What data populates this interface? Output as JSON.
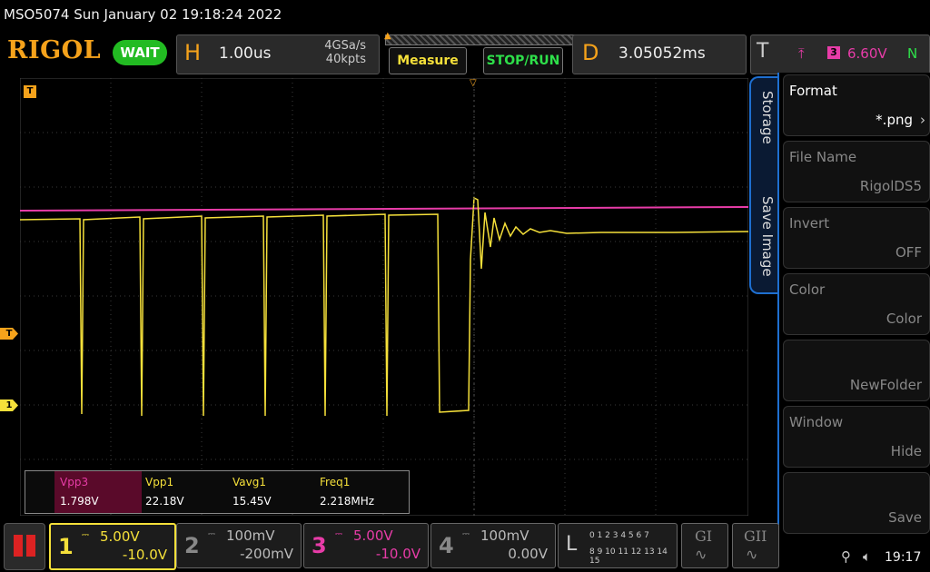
{
  "status": {
    "text": "MSO5074  Sun January 02 19:18:24 2022"
  },
  "header": {
    "logo": "RIGOL",
    "run_state": "WAIT",
    "horizontal": {
      "letter": "H",
      "timebase": "1.00us",
      "sample_rate": "4GSa/s",
      "memory": "40kpts"
    },
    "measure_label": "Measure",
    "stoprun_label": "STOP/RUN",
    "delay": {
      "letter": "D",
      "value": "3.05052ms"
    },
    "trigger": {
      "letter": "T",
      "source": "3",
      "level": "6.60V",
      "mode": "N"
    }
  },
  "side_tabs": {
    "storage": "Storage",
    "save_image": "Save Image"
  },
  "menu": [
    {
      "title": "Format",
      "value": "*.png"
    },
    {
      "title": "File Name",
      "value": "RigolDS5"
    },
    {
      "title": "Invert",
      "value": "OFF"
    },
    {
      "title": "Color",
      "value": "Color"
    },
    {
      "title": "",
      "value": "NewFolder"
    },
    {
      "title": "Window",
      "value": "Hide"
    },
    {
      "title": "",
      "value": "Save"
    }
  ],
  "markers": {
    "trigger_top": "T",
    "trigger_level": "T",
    "ch1": "1"
  },
  "measurements": {
    "headers": [
      "Vpp3",
      "Vpp1",
      "Vavg1",
      "Freq1"
    ],
    "values": [
      "1.798V",
      "22.18V",
      "15.45V",
      "2.218MHz"
    ]
  },
  "channels": [
    {
      "num": "1",
      "scale": "5.00V",
      "offset": "-10.0V",
      "color": "#f5e03a"
    },
    {
      "num": "2",
      "scale": "100mV",
      "offset": "-200mV",
      "color": "#888888"
    },
    {
      "num": "3",
      "scale": "5.00V",
      "offset": "-10.0V",
      "color": "#e83ca8"
    },
    {
      "num": "4",
      "scale": "100mV",
      "offset": "0.00V",
      "color": "#888888"
    }
  ],
  "logic": {
    "letter": "L",
    "row1": "0 1 2 3  4 5 6 7",
    "row2": "8 9 10 11 12 13 14 15"
  },
  "gi_labels": [
    "GI",
    "GII"
  ],
  "systray": {
    "time": "19:17"
  },
  "colors": {
    "ch1": "#f5e03a",
    "ch3": "#e83ca8",
    "accent": "#f5a21b",
    "menu_border": "#1e6fd0"
  }
}
